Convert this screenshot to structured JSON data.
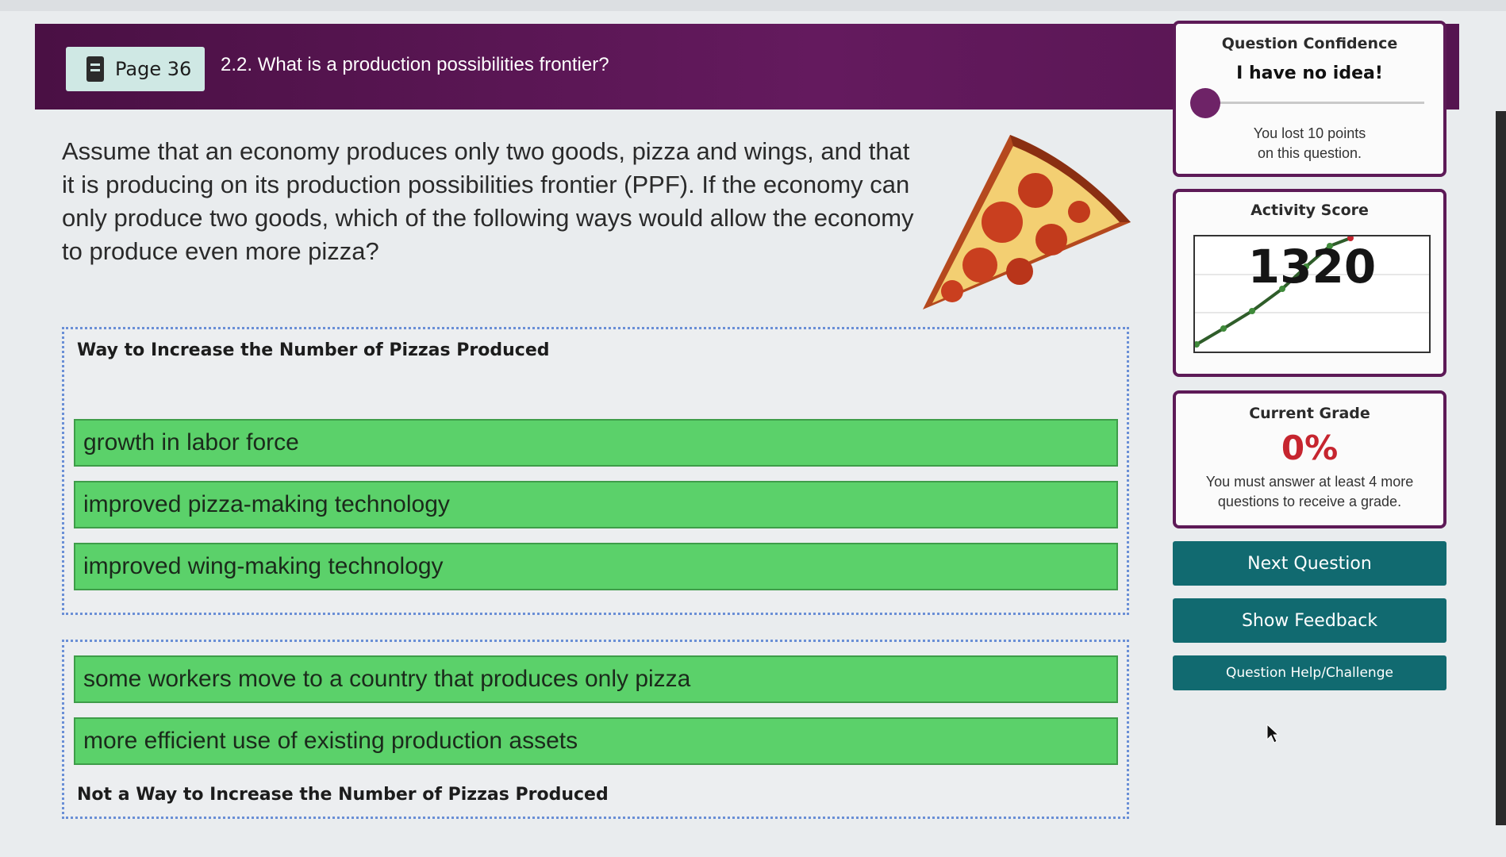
{
  "header": {
    "page_label": "Page 36",
    "title": "2.2. What is a production possibilities frontier?"
  },
  "question": {
    "text": "Assume that an economy produces only two goods, pizza and wings, and that it is producing on its production possibilities frontier (PPF). If the economy can only produce two goods, which of the following ways would allow the economy to produce even more pizza?"
  },
  "zones": {
    "increase": {
      "title": "Way to Increase the Number of Pizzas Produced",
      "items": [
        "growth in labor force",
        "improved pizza-making technology",
        "improved wing-making technology"
      ]
    },
    "not_increase": {
      "title": "Not a Way to Increase the Number of Pizzas Produced",
      "items": [
        "some workers move to a country that produces only pizza",
        "more efficient use of existing production assets"
      ]
    }
  },
  "confidence": {
    "title": "Question Confidence",
    "value": "I have no idea!",
    "note_line1": "You lost 10 points",
    "note_line2": "on this question."
  },
  "activity": {
    "title": "Activity Score",
    "score": "1320"
  },
  "grade": {
    "title": "Current Grade",
    "value": "0%",
    "note_line1": "You must answer at least 4 more",
    "note_line2": "questions to receive a grade."
  },
  "buttons": {
    "next": "Next Question",
    "feedback": "Show Feedback",
    "help": "Question Help/Challenge"
  },
  "colors": {
    "header_purple": "#641a5e",
    "item_green": "#5bd16a",
    "button_teal": "#116a70",
    "grade_red": "#c6252f"
  }
}
